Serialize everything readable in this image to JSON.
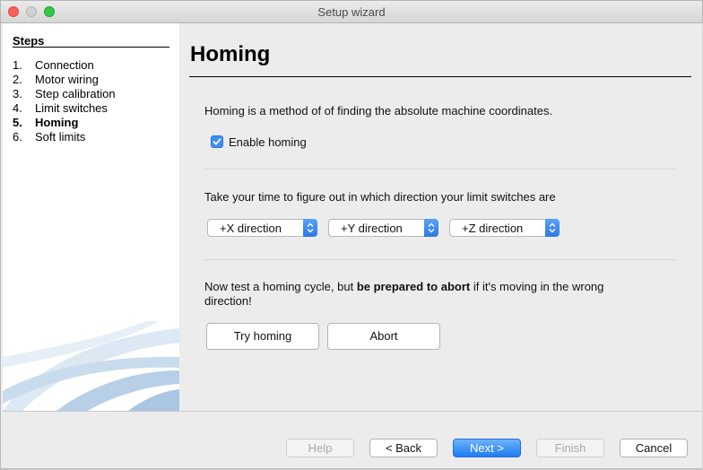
{
  "window": {
    "title": "Setup wizard"
  },
  "sidebar": {
    "heading": "Steps",
    "steps": [
      {
        "num": "1.",
        "label": "Connection"
      },
      {
        "num": "2.",
        "label": "Motor wiring"
      },
      {
        "num": "3.",
        "label": "Step calibration"
      },
      {
        "num": "4.",
        "label": "Limit switches"
      },
      {
        "num": "5.",
        "label": "Homing",
        "current": true
      },
      {
        "num": "6.",
        "label": "Soft limits"
      }
    ]
  },
  "page": {
    "title": "Homing",
    "intro": "Homing is a method of of finding the absolute machine coordinates.",
    "enable_homing": {
      "label": "Enable homing",
      "checked": true
    },
    "direction_prompt": "Take your time to figure out in which direction your limit switches are",
    "directions": {
      "x": "+X direction",
      "y": "+Y direction",
      "z": "+Z direction"
    },
    "test_prompt": {
      "before": "Now test a homing cycle, but ",
      "bold": "be prepared to abort",
      "after": " if it's moving in the wrong",
      "line2": "direction!"
    },
    "try_homing_label": "Try homing",
    "abort_label": "Abort"
  },
  "footer": {
    "help_label": "Help",
    "back_label": "< Back",
    "next_label": "Next >",
    "finish_label": "Finish",
    "cancel_label": "Cancel"
  },
  "colors": {
    "accent": "#2b78e5",
    "checkbox": "#3d8ef5"
  }
}
